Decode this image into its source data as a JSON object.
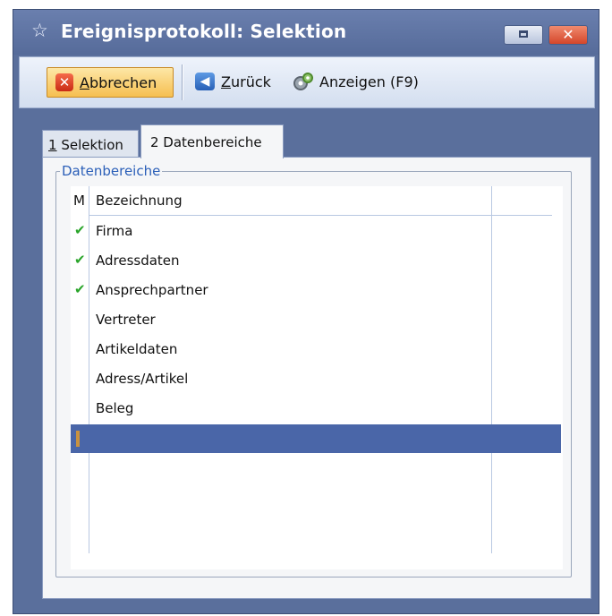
{
  "window": {
    "title": "Ereignisprotokoll: Selektion",
    "controls": {
      "restore_icon": "restore-icon",
      "close_icon": "close-icon"
    }
  },
  "toolbar": {
    "cancel": {
      "mnemonic": "A",
      "rest": "bbrechen",
      "icon": "cancel-x-icon"
    },
    "back": {
      "mnemonic": "Z",
      "rest": "urück",
      "icon": "arrow-left-icon"
    },
    "show": {
      "label": "Anzeigen (F9)",
      "icon": "gears-icon"
    }
  },
  "tabs": [
    {
      "mnemonic": "1",
      "rest": " Selektion",
      "active": false
    },
    {
      "label": "2 Datenbereiche",
      "active": true
    }
  ],
  "groupbox": {
    "legend": "Datenbereiche"
  },
  "grid": {
    "columns": [
      "M",
      "Bezeichnung"
    ],
    "rows": [
      {
        "marked": true,
        "mark": "✔",
        "label": "Firma"
      },
      {
        "marked": true,
        "mark": "✔",
        "label": "Adressdaten"
      },
      {
        "marked": true,
        "mark": "✔",
        "label": "Ansprechpartner"
      },
      {
        "marked": false,
        "mark": "",
        "label": "Vertreter"
      },
      {
        "marked": false,
        "mark": "",
        "label": "Artikeldaten"
      },
      {
        "marked": false,
        "mark": "",
        "label": "Adress/Artikel"
      },
      {
        "marked": false,
        "mark": "",
        "label": "Beleg"
      },
      {
        "marked": false,
        "mark": "",
        "label": "",
        "selected": true
      }
    ]
  },
  "colors": {
    "frame": "#5a6f9c",
    "accent_button": "#f6bf50",
    "check": "#2aa52a",
    "selection": "#4a66a8",
    "legend": "#2b5fb8"
  }
}
